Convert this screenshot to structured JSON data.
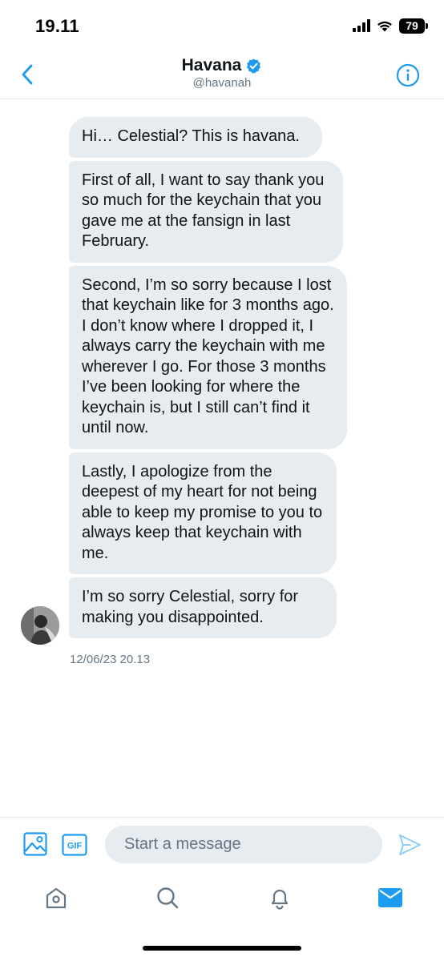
{
  "status_bar": {
    "time": "19.11",
    "battery": "79"
  },
  "header": {
    "name": "Havana",
    "handle": "@havanah"
  },
  "messages": [
    {
      "text": "Hi… Celestial? This is havana."
    },
    {
      "text": "First of all, I want to say thank you so much for the keychain that you gave me at the fansign in last February."
    },
    {
      "text": "Second, I’m so sorry because I lost that keychain like for 3 months ago. I don’t know where I dropped it, I always carry the keychain with me wherever I go. For those 3 months I’ve been looking for where the keychain is, but I still can’t find it until now."
    },
    {
      "text": "Lastly, I apologize from the deepest of my heart for not being able to keep my promise to you to always keep that keychain with me."
    },
    {
      "text": "I’m so sorry Celestial, sorry for making you disappointed."
    }
  ],
  "timestamp": "12/06/23 20.13",
  "composer": {
    "placeholder": "Start a message",
    "gif_label": "GIF"
  },
  "colors": {
    "accent": "#1d9bf0",
    "bubble": "#e6ecf0",
    "muted": "#657786"
  },
  "icons": {
    "back": "chevron-left-icon",
    "verified": "verified-badge-icon",
    "info": "info-icon",
    "image": "image-icon",
    "gif": "gif-icon",
    "send": "send-icon",
    "home": "home-icon",
    "search": "search-icon",
    "notifications": "bell-icon",
    "messages": "mail-icon"
  }
}
